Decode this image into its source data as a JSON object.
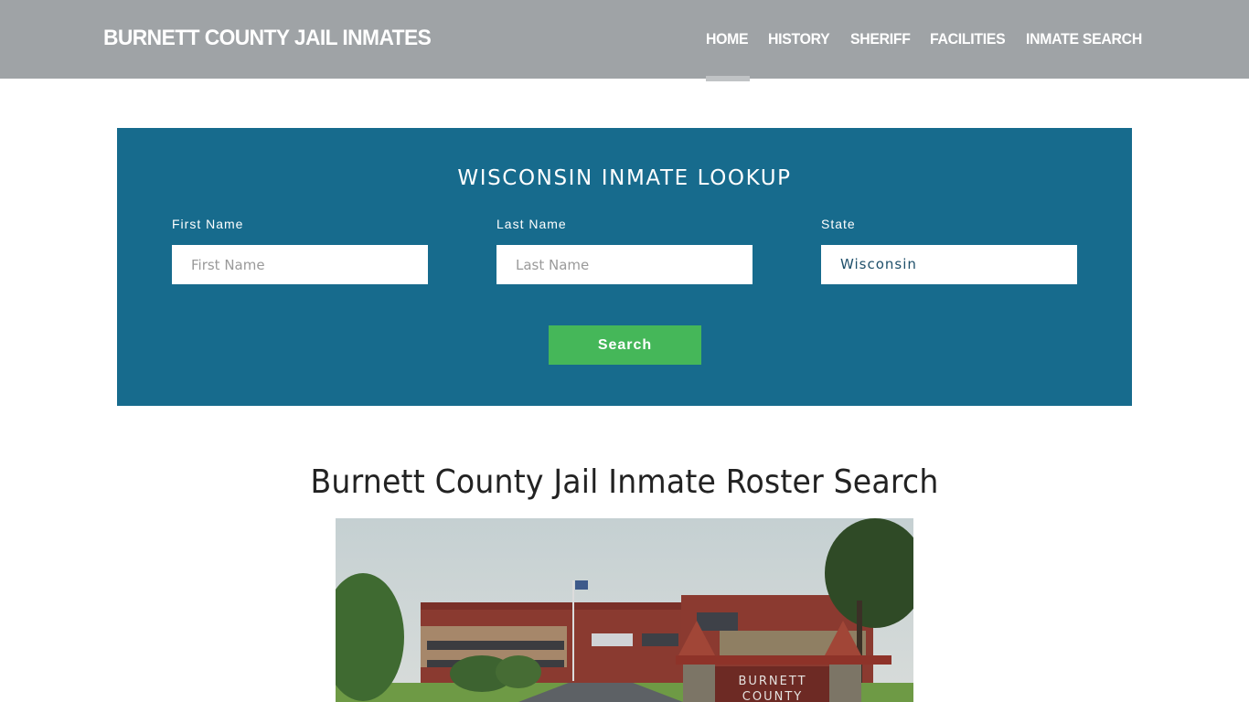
{
  "header": {
    "brand": "BURNETT COUNTY JAIL INMATES",
    "nav": [
      {
        "label": "HOME",
        "active": true
      },
      {
        "label": "HISTORY",
        "active": false
      },
      {
        "label": "SHERIFF",
        "active": false
      },
      {
        "label": "FACILITIES",
        "active": false
      },
      {
        "label": "INMATE SEARCH",
        "active": false
      }
    ]
  },
  "lookup": {
    "title": "WISCONSIN INMATE LOOKUP",
    "first_name": {
      "label": "First Name",
      "placeholder": "First Name",
      "value": ""
    },
    "last_name": {
      "label": "Last Name",
      "placeholder": "Last Name",
      "value": ""
    },
    "state": {
      "label": "State",
      "value": "Wisconsin"
    },
    "search_label": "Search"
  },
  "main": {
    "heading": "Burnett County Jail Inmate Roster Search",
    "image": {
      "alt": "Burnett County Jail building",
      "sign_line1": "BURNETT",
      "sign_line2": "COUNTY"
    }
  },
  "colors": {
    "header_bg": "#9fa3a6",
    "lookup_bg": "#176b8d",
    "search_button": "#45b759"
  }
}
